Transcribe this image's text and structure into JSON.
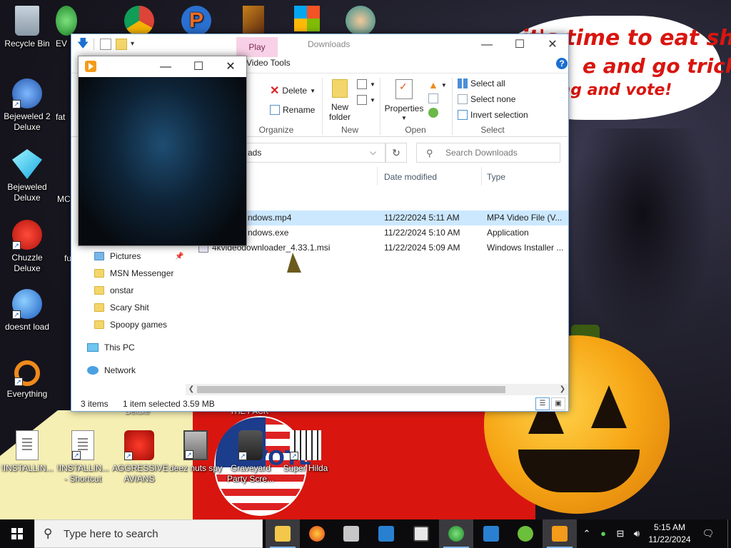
{
  "wallpaper": {
    "bubble_line1": "it's time to eat shit",
    "bubble_line2": "e and go trick",
    "bubble_line3": "ing and vote!",
    "vote_text": "VOTE"
  },
  "desktop_icons": [
    {
      "label": "Recycle Bin",
      "icon": "recycle-bin-icon"
    },
    {
      "label": "Bejeweled 2 Deluxe",
      "icon": "bejeweled-2-icon"
    },
    {
      "label": "Bejeweled Deluxe",
      "icon": "bejeweled-icon"
    },
    {
      "label": "Chuzzle Deluxe",
      "icon": "chuzzle-icon"
    },
    {
      "label": "doesnt load",
      "icon": "thunderbird-icon"
    },
    {
      "label": "Everything",
      "icon": "everything-search-icon"
    },
    {
      "label": "!INSTALLIN...",
      "icon": "document-icon"
    },
    {
      "label": "!INSTALLIN... - Shortcut",
      "icon": "document-icon"
    },
    {
      "label": "AGGRESSIVE AVIANS",
      "icon": "angry-bird-icon"
    },
    {
      "label": "deez nuts spy",
      "icon": "stacked-windows-icon"
    },
    {
      "label": "Graveyard Party Scre...",
      "icon": "graveyard-icon"
    },
    {
      "label": "Super Hilda",
      "icon": "pixel-dog-icon"
    },
    {
      "label": "EV",
      "icon": "msn-people-icon"
    },
    {
      "label": "fat",
      "icon": "partial-icon"
    },
    {
      "label": "MC",
      "icon": "partial-icon"
    },
    {
      "label": "fu",
      "icon": "partial-icon"
    }
  ],
  "partial_labels": {
    "deluxe": "Deluxe",
    "thepack": "THE PACK"
  },
  "explorer": {
    "contextual_tab": "Play",
    "title": "Downloads",
    "ribbon_tab": "Video Tools",
    "help": "?",
    "ribbon": {
      "delete": "Delete",
      "rename": "Rename",
      "organize_label": "Organize",
      "new_folder_line1": "New",
      "new_folder_line2": "folder",
      "new_label": "New",
      "properties": "Properties",
      "open_label": "Open",
      "select_all": "Select all",
      "select_none": "Select none",
      "invert_selection": "Invert selection",
      "select_label": "Select"
    },
    "address": "ads",
    "search_placeholder": "Search Downloads",
    "columns": {
      "date": "Date modified",
      "type": "Type"
    },
    "files": [
      {
        "name": "ndows.mp4",
        "date": "11/22/2024 5:11 AM",
        "type": "MP4 Video File (V..."
      },
      {
        "name": "ndows.exe",
        "date": "11/22/2024 5:10 AM",
        "type": "Application"
      },
      {
        "name": "4kvideodownloader_4.33.1.msi",
        "date": "11/22/2024 5:09 AM",
        "type": "Windows Installer ..."
      }
    ],
    "nav": [
      "Pictures",
      "MSN Messenger",
      "onstar",
      "Scary Shit",
      "Spoopy games",
      "This PC",
      "Network"
    ],
    "status": {
      "items": "3 items",
      "selected": "1 item selected  3.59 MB"
    }
  },
  "taskbar": {
    "search_placeholder": "Type here to search",
    "time": "5:15 AM",
    "date": "11/22/2024"
  },
  "colors": {
    "selection": "#cce8ff",
    "play_tab": "#f8d1e6",
    "taskbar": "#0b0b0d",
    "bubble_text": "#d8160f"
  }
}
